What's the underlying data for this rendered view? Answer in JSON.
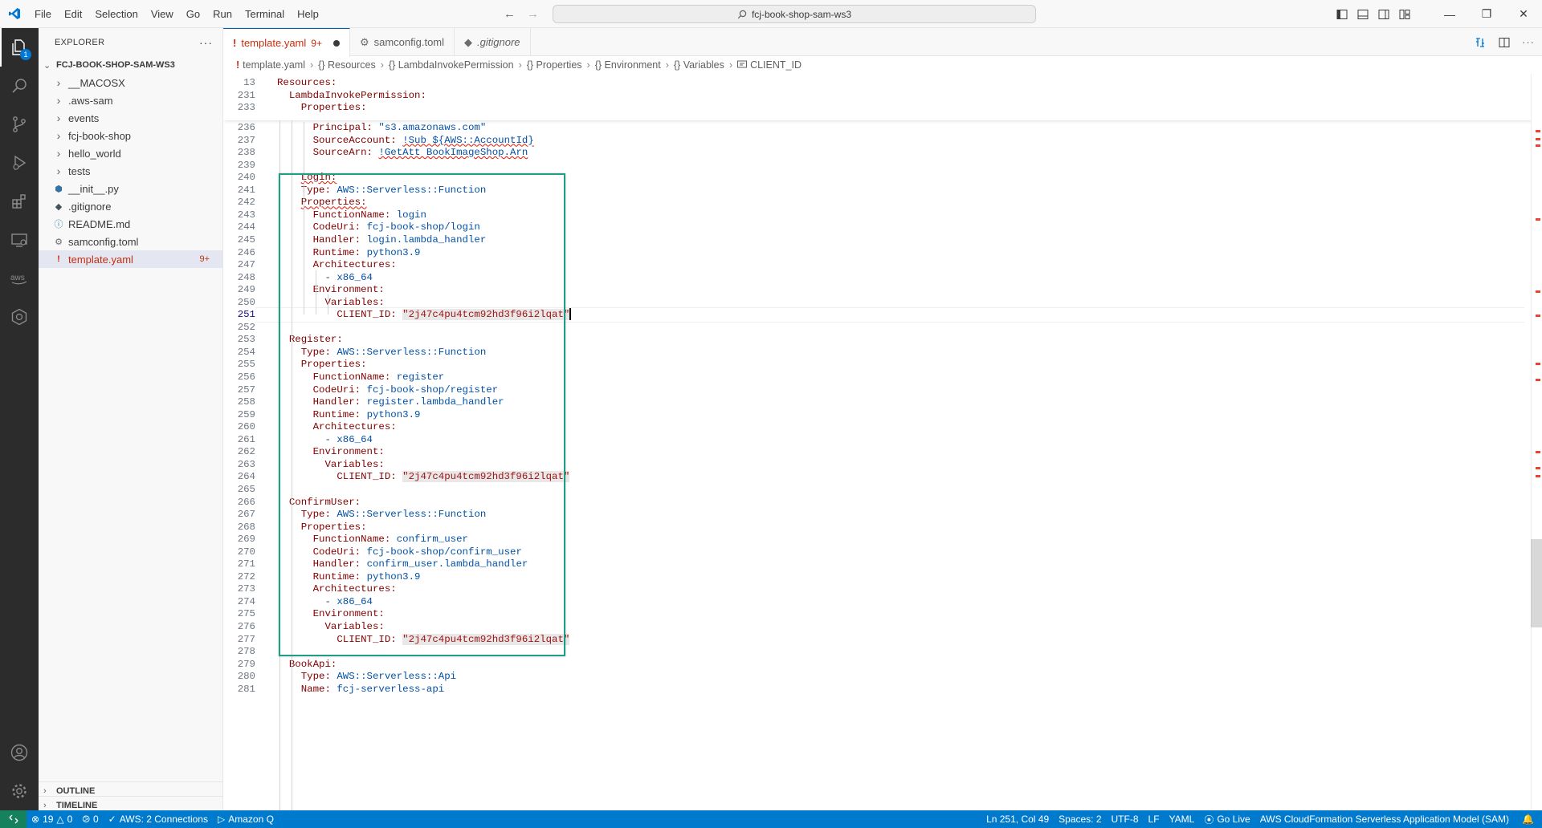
{
  "menu": [
    "File",
    "Edit",
    "Selection",
    "View",
    "Go",
    "Run",
    "Terminal",
    "Help"
  ],
  "command_center": "fcj-book-shop-sam-ws3",
  "explorer": {
    "title": "EXPLORER",
    "more": "···",
    "project": "FCJ-BOOK-SHOP-SAM-WS3",
    "items": [
      {
        "label": "__MACOSX",
        "kind": "folder"
      },
      {
        "label": ".aws-sam",
        "kind": "folder"
      },
      {
        "label": "events",
        "kind": "folder"
      },
      {
        "label": "fcj-book-shop",
        "kind": "folder"
      },
      {
        "label": "hello_world",
        "kind": "folder"
      },
      {
        "label": "tests",
        "kind": "folder"
      },
      {
        "label": "__init__.py",
        "kind": "python"
      },
      {
        "label": ".gitignore",
        "kind": "git"
      },
      {
        "label": "README.md",
        "kind": "info"
      },
      {
        "label": "samconfig.toml",
        "kind": "gear"
      },
      {
        "label": "template.yaml",
        "kind": "yaml",
        "count": "9+",
        "selected": true
      }
    ],
    "outline": "OUTLINE",
    "timeline": "TIMELINE"
  },
  "activity_badge": "1",
  "tabs": [
    {
      "label": "template.yaml",
      "count": "9+",
      "active": true,
      "icon": "!"
    },
    {
      "label": "samconfig.toml",
      "active": false,
      "icon": "⚙"
    },
    {
      "label": ".gitignore",
      "active": false,
      "icon": "◆"
    }
  ],
  "breadcrumbs": [
    "template.yaml",
    "{} Resources",
    "{} LambdaInvokePermission",
    "{} Properties",
    "{} Environment",
    "{} Variables",
    "CLIENT_ID"
  ],
  "sticky_lines": [
    {
      "n": "13",
      "parts": [
        {
          "t": "Resources:",
          "c": "k"
        }
      ]
    },
    {
      "n": "231",
      "parts": [
        {
          "t": "  "
        },
        {
          "t": "LambdaInvokePermission:",
          "c": "k"
        }
      ]
    },
    {
      "n": "233",
      "parts": [
        {
          "t": "    "
        },
        {
          "t": "Properties:",
          "c": "k"
        }
      ]
    }
  ],
  "code_lines": [
    {
      "n": "236",
      "parts": [
        {
          "t": "      "
        },
        {
          "t": "Principal:",
          "c": "k"
        },
        {
          "t": " "
        },
        {
          "t": "\"s3.amazonaws.com\"",
          "c": "s"
        }
      ]
    },
    {
      "n": "237",
      "parts": [
        {
          "t": "      "
        },
        {
          "t": "SourceAccount:",
          "c": "k"
        },
        {
          "t": " "
        },
        {
          "t": "!Sub ${AWS::AccountId}",
          "c": "s err"
        }
      ]
    },
    {
      "n": "238",
      "parts": [
        {
          "t": "      "
        },
        {
          "t": "SourceArn:",
          "c": "k"
        },
        {
          "t": " "
        },
        {
          "t": "!GetAtt BookImageShop.Arn",
          "c": "s err"
        }
      ]
    },
    {
      "n": "239",
      "parts": []
    },
    {
      "n": "240",
      "parts": [
        {
          "t": "    "
        },
        {
          "t": "Login:",
          "c": "k err"
        }
      ]
    },
    {
      "n": "241",
      "parts": [
        {
          "t": "    "
        },
        {
          "t": "Type:",
          "c": "k"
        },
        {
          "t": " "
        },
        {
          "t": "AWS::Serverless::Function",
          "c": "s"
        }
      ]
    },
    {
      "n": "242",
      "parts": [
        {
          "t": "    "
        },
        {
          "t": "Properties:",
          "c": "k err"
        }
      ]
    },
    {
      "n": "243",
      "parts": [
        {
          "t": "      "
        },
        {
          "t": "FunctionName:",
          "c": "k"
        },
        {
          "t": " "
        },
        {
          "t": "login",
          "c": "s"
        }
      ]
    },
    {
      "n": "244",
      "parts": [
        {
          "t": "      "
        },
        {
          "t": "CodeUri:",
          "c": "k"
        },
        {
          "t": " "
        },
        {
          "t": "fcj-book-shop/login",
          "c": "s"
        }
      ]
    },
    {
      "n": "245",
      "parts": [
        {
          "t": "      "
        },
        {
          "t": "Handler:",
          "c": "k"
        },
        {
          "t": " "
        },
        {
          "t": "login.lambda_handler",
          "c": "s"
        }
      ]
    },
    {
      "n": "246",
      "parts": [
        {
          "t": "      "
        },
        {
          "t": "Runtime:",
          "c": "k"
        },
        {
          "t": " "
        },
        {
          "t": "python3.9",
          "c": "s"
        }
      ]
    },
    {
      "n": "247",
      "parts": [
        {
          "t": "      "
        },
        {
          "t": "Architectures:",
          "c": "k"
        }
      ]
    },
    {
      "n": "248",
      "parts": [
        {
          "t": "        - "
        },
        {
          "t": "x86_64",
          "c": "s"
        }
      ]
    },
    {
      "n": "249",
      "parts": [
        {
          "t": "      "
        },
        {
          "t": "Environment:",
          "c": "k"
        }
      ]
    },
    {
      "n": "250",
      "parts": [
        {
          "t": "        "
        },
        {
          "t": "Variables:",
          "c": "k"
        }
      ]
    },
    {
      "n": "251",
      "cur": true,
      "parts": [
        {
          "t": "          "
        },
        {
          "t": "CLIENT_ID:",
          "c": "k"
        },
        {
          "t": " "
        },
        {
          "t": "\"2j47c4pu4tcm92hd3f96i2lqat\"",
          "c": "str"
        }
      ]
    },
    {
      "n": "252",
      "parts": []
    },
    {
      "n": "253",
      "parts": [
        {
          "t": "  "
        },
        {
          "t": "Register:",
          "c": "k"
        }
      ]
    },
    {
      "n": "254",
      "parts": [
        {
          "t": "    "
        },
        {
          "t": "Type:",
          "c": "k"
        },
        {
          "t": " "
        },
        {
          "t": "AWS::Serverless::Function",
          "c": "s"
        }
      ]
    },
    {
      "n": "255",
      "parts": [
        {
          "t": "    "
        },
        {
          "t": "Properties:",
          "c": "k"
        }
      ]
    },
    {
      "n": "256",
      "parts": [
        {
          "t": "      "
        },
        {
          "t": "FunctionName:",
          "c": "k"
        },
        {
          "t": " "
        },
        {
          "t": "register",
          "c": "s"
        }
      ]
    },
    {
      "n": "257",
      "parts": [
        {
          "t": "      "
        },
        {
          "t": "CodeUri:",
          "c": "k"
        },
        {
          "t": " "
        },
        {
          "t": "fcj-book-shop/register",
          "c": "s"
        }
      ]
    },
    {
      "n": "258",
      "parts": [
        {
          "t": "      "
        },
        {
          "t": "Handler:",
          "c": "k"
        },
        {
          "t": " "
        },
        {
          "t": "register.lambda_handler",
          "c": "s"
        }
      ]
    },
    {
      "n": "259",
      "parts": [
        {
          "t": "      "
        },
        {
          "t": "Runtime:",
          "c": "k"
        },
        {
          "t": " "
        },
        {
          "t": "python3.9",
          "c": "s"
        }
      ]
    },
    {
      "n": "260",
      "parts": [
        {
          "t": "      "
        },
        {
          "t": "Architectures:",
          "c": "k"
        }
      ]
    },
    {
      "n": "261",
      "parts": [
        {
          "t": "        - "
        },
        {
          "t": "x86_64",
          "c": "s"
        }
      ]
    },
    {
      "n": "262",
      "parts": [
        {
          "t": "      "
        },
        {
          "t": "Environment:",
          "c": "k"
        }
      ]
    },
    {
      "n": "263",
      "parts": [
        {
          "t": "        "
        },
        {
          "t": "Variables:",
          "c": "k"
        }
      ]
    },
    {
      "n": "264",
      "parts": [
        {
          "t": "          "
        },
        {
          "t": "CLIENT_ID:",
          "c": "k"
        },
        {
          "t": " "
        },
        {
          "t": "\"2j47c4pu4tcm92hd3f96i2lqat\"",
          "c": "str"
        }
      ]
    },
    {
      "n": "265",
      "parts": []
    },
    {
      "n": "266",
      "parts": [
        {
          "t": "  "
        },
        {
          "t": "ConfirmUser:",
          "c": "k"
        }
      ]
    },
    {
      "n": "267",
      "parts": [
        {
          "t": "    "
        },
        {
          "t": "Type:",
          "c": "k"
        },
        {
          "t": " "
        },
        {
          "t": "AWS::Serverless::Function",
          "c": "s"
        }
      ]
    },
    {
      "n": "268",
      "parts": [
        {
          "t": "    "
        },
        {
          "t": "Properties:",
          "c": "k"
        }
      ]
    },
    {
      "n": "269",
      "parts": [
        {
          "t": "      "
        },
        {
          "t": "FunctionName:",
          "c": "k"
        },
        {
          "t": " "
        },
        {
          "t": "confirm_user",
          "c": "s"
        }
      ]
    },
    {
      "n": "270",
      "parts": [
        {
          "t": "      "
        },
        {
          "t": "CodeUri:",
          "c": "k"
        },
        {
          "t": " "
        },
        {
          "t": "fcj-book-shop/confirm_user",
          "c": "s"
        }
      ]
    },
    {
      "n": "271",
      "parts": [
        {
          "t": "      "
        },
        {
          "t": "Handler:",
          "c": "k"
        },
        {
          "t": " "
        },
        {
          "t": "confirm_user.lambda_handler",
          "c": "s"
        }
      ]
    },
    {
      "n": "272",
      "parts": [
        {
          "t": "      "
        },
        {
          "t": "Runtime:",
          "c": "k"
        },
        {
          "t": " "
        },
        {
          "t": "python3.9",
          "c": "s"
        }
      ]
    },
    {
      "n": "273",
      "parts": [
        {
          "t": "      "
        },
        {
          "t": "Architectures:",
          "c": "k"
        }
      ]
    },
    {
      "n": "274",
      "parts": [
        {
          "t": "        - "
        },
        {
          "t": "x86_64",
          "c": "s"
        }
      ]
    },
    {
      "n": "275",
      "parts": [
        {
          "t": "      "
        },
        {
          "t": "Environment:",
          "c": "k"
        }
      ]
    },
    {
      "n": "276",
      "parts": [
        {
          "t": "        "
        },
        {
          "t": "Variables:",
          "c": "k"
        }
      ]
    },
    {
      "n": "277",
      "parts": [
        {
          "t": "          "
        },
        {
          "t": "CLIENT_ID:",
          "c": "k"
        },
        {
          "t": " "
        },
        {
          "t": "\"2j47c4pu4tcm92hd3f96i2lqat\"",
          "c": "str"
        }
      ]
    },
    {
      "n": "278",
      "parts": []
    },
    {
      "n": "279",
      "parts": [
        {
          "t": "  "
        },
        {
          "t": "BookApi:",
          "c": "k"
        }
      ]
    },
    {
      "n": "280",
      "parts": [
        {
          "t": "    "
        },
        {
          "t": "Type:",
          "c": "k"
        },
        {
          "t": " "
        },
        {
          "t": "AWS::Serverless::Api",
          "c": "s"
        }
      ]
    },
    {
      "n": "281",
      "parts": [
        {
          "t": "    "
        },
        {
          "t": "Name:",
          "c": "k"
        },
        {
          "t": " "
        },
        {
          "t": "fcj-serverless-api",
          "c": "s"
        }
      ]
    }
  ],
  "status": {
    "errors": "19",
    "warnings": "0",
    "ports": "0",
    "aws": "AWS: 2 Connections",
    "amazon_q": "Amazon Q",
    "position": "Ln 251, Col 49",
    "spaces": "Spaces: 2",
    "encoding": "UTF-8",
    "eol": "LF",
    "language": "YAML",
    "golive": "Go Live",
    "schema": "AWS CloudFormation Serverless Application Model (SAM)"
  },
  "colors": {
    "accent": "#007acc",
    "highlight_box": "#1f9e83",
    "error": "#c72e0f",
    "key": "#800000",
    "value": "#0451a5"
  }
}
